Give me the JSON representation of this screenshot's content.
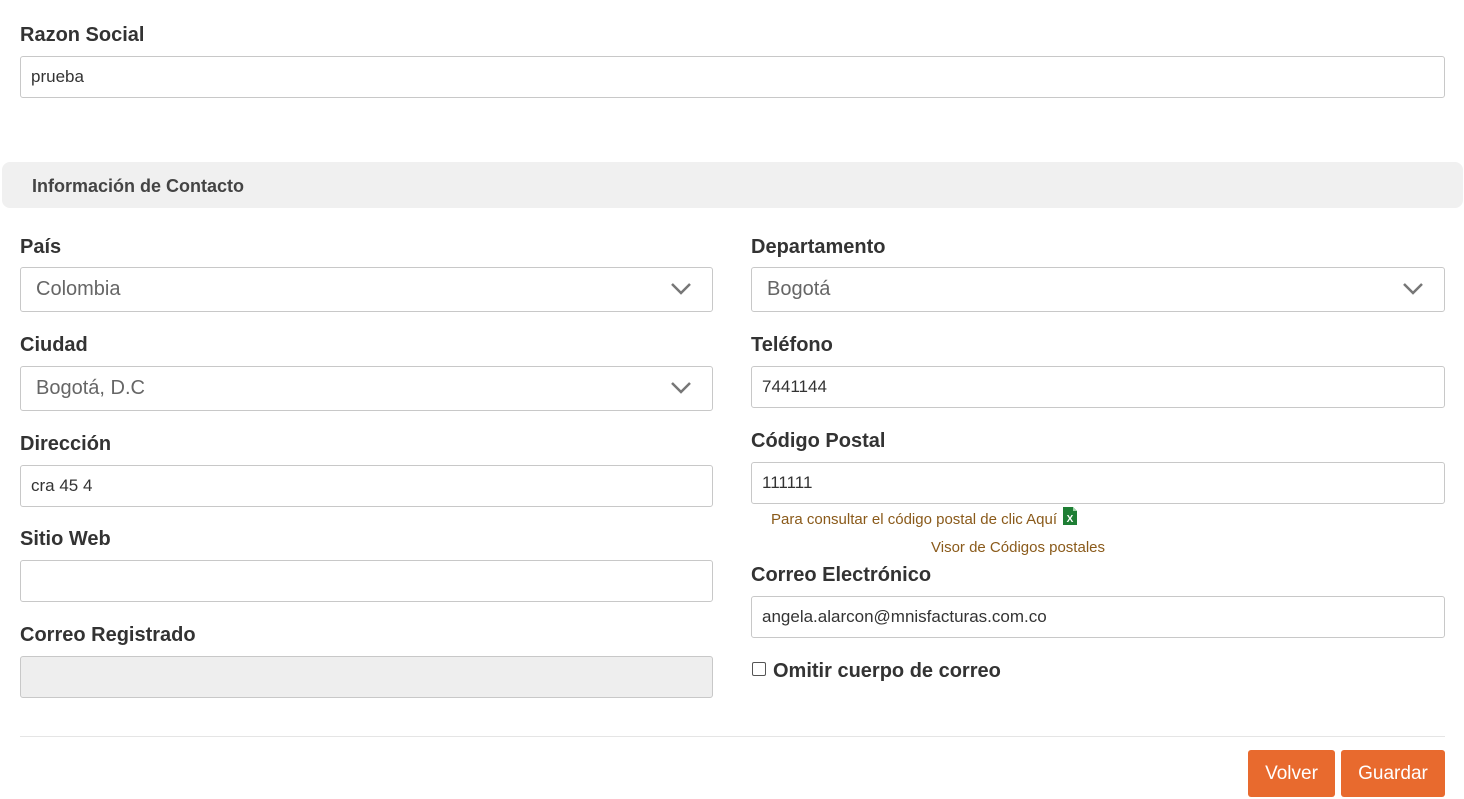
{
  "razon_social": {
    "label": "Razon Social",
    "value": "prueba"
  },
  "section": {
    "title": "Información de Contacto"
  },
  "pais": {
    "label": "País",
    "value": "Colombia"
  },
  "departamento": {
    "label": "Departamento",
    "value": "Bogotá"
  },
  "ciudad": {
    "label": "Ciudad",
    "value": "Bogotá, D.C"
  },
  "telefono": {
    "label": "Teléfono",
    "value": "7441144"
  },
  "direccion": {
    "label": "Dirección",
    "value": "cra 45 4"
  },
  "codigo_postal": {
    "label": "Código Postal",
    "value": "111111",
    "help_link": "Para consultar el código postal de clic Aquí",
    "viewer_link": "Visor de Códigos postales"
  },
  "sitio_web": {
    "label": "Sitio Web",
    "value": ""
  },
  "correo_electronico": {
    "label": "Correo Electrónico",
    "value": "angela.alarcon@mnisfacturas.com.co"
  },
  "correo_registrado": {
    "label": "Correo Registrado",
    "value": ""
  },
  "omitir": {
    "label": "Omitir cuerpo de correo",
    "checked": false
  },
  "buttons": {
    "volver": "Volver",
    "guardar": "Guardar"
  },
  "icons": {
    "select_chevron": "chevron-down-icon",
    "excel": "excel-icon"
  },
  "colors": {
    "accent": "#e86a2e",
    "link": "#8a5a1a",
    "section_bg": "#f0f0f0",
    "excel_green": "#1e7e34"
  }
}
